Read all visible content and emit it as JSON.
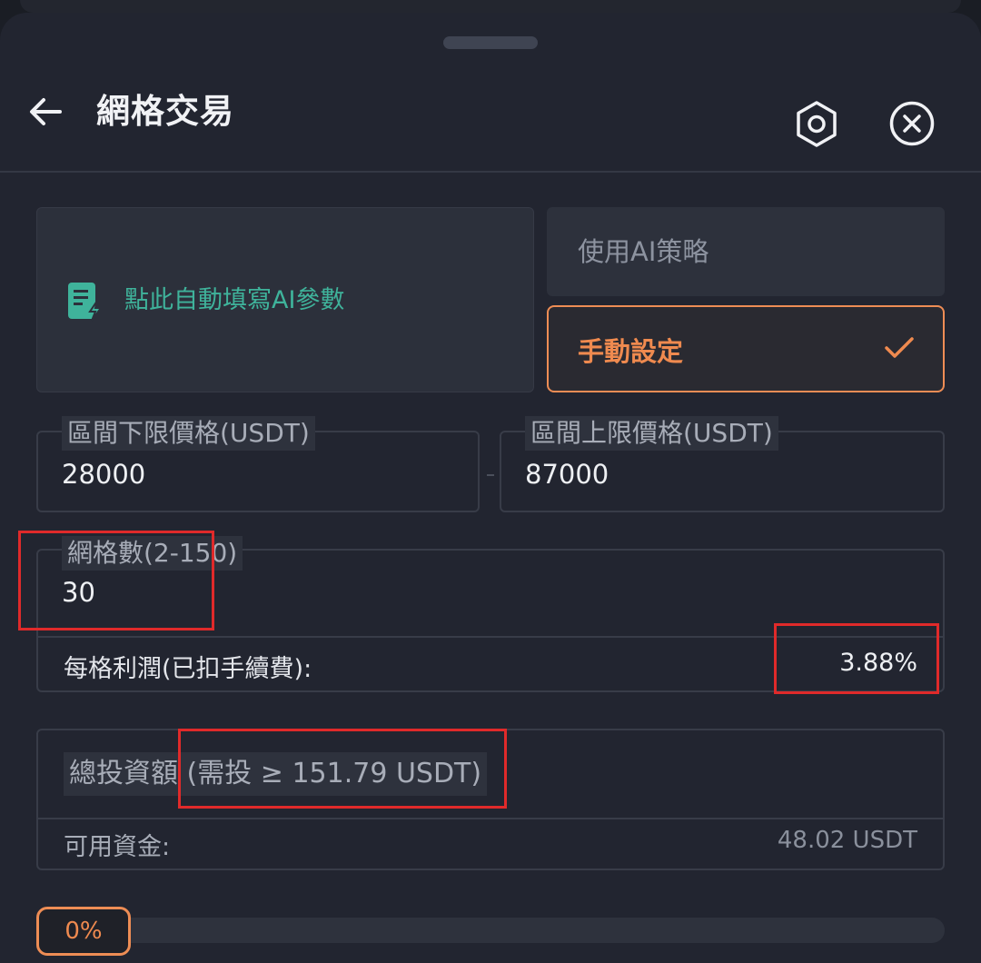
{
  "header": {
    "title": "網格交易"
  },
  "mode": {
    "ai_fill_text": "點此自動填寫AI參數",
    "option_ai": "使用AI策略",
    "option_manual": "手動設定",
    "selected": "手動設定"
  },
  "range": {
    "lower_label": "區間下限價格(USDT)",
    "lower_value": "28000",
    "upper_label": "區間上限價格(USDT)",
    "upper_value": "87000"
  },
  "grid": {
    "count_label": "網格數(2-150)",
    "count_value": "30",
    "profit_label": "每格利潤(已扣手續費):",
    "profit_value": "3.88%"
  },
  "investment": {
    "label": "總投資額 (需投 ≥ 151.79 USDT)",
    "available_label": "可用資金:",
    "available_value": "48.02 USDT"
  },
  "slider": {
    "percent_label": "0%",
    "percent": 0
  },
  "colors": {
    "accent": "#ee8d55",
    "ai_green": "#3fb39b",
    "annotation_red": "#e02a2a"
  },
  "icons": [
    "back-arrow-icon",
    "settings-hexagon-icon",
    "close-circle-icon",
    "ai-document-icon",
    "checkmark-icon"
  ]
}
